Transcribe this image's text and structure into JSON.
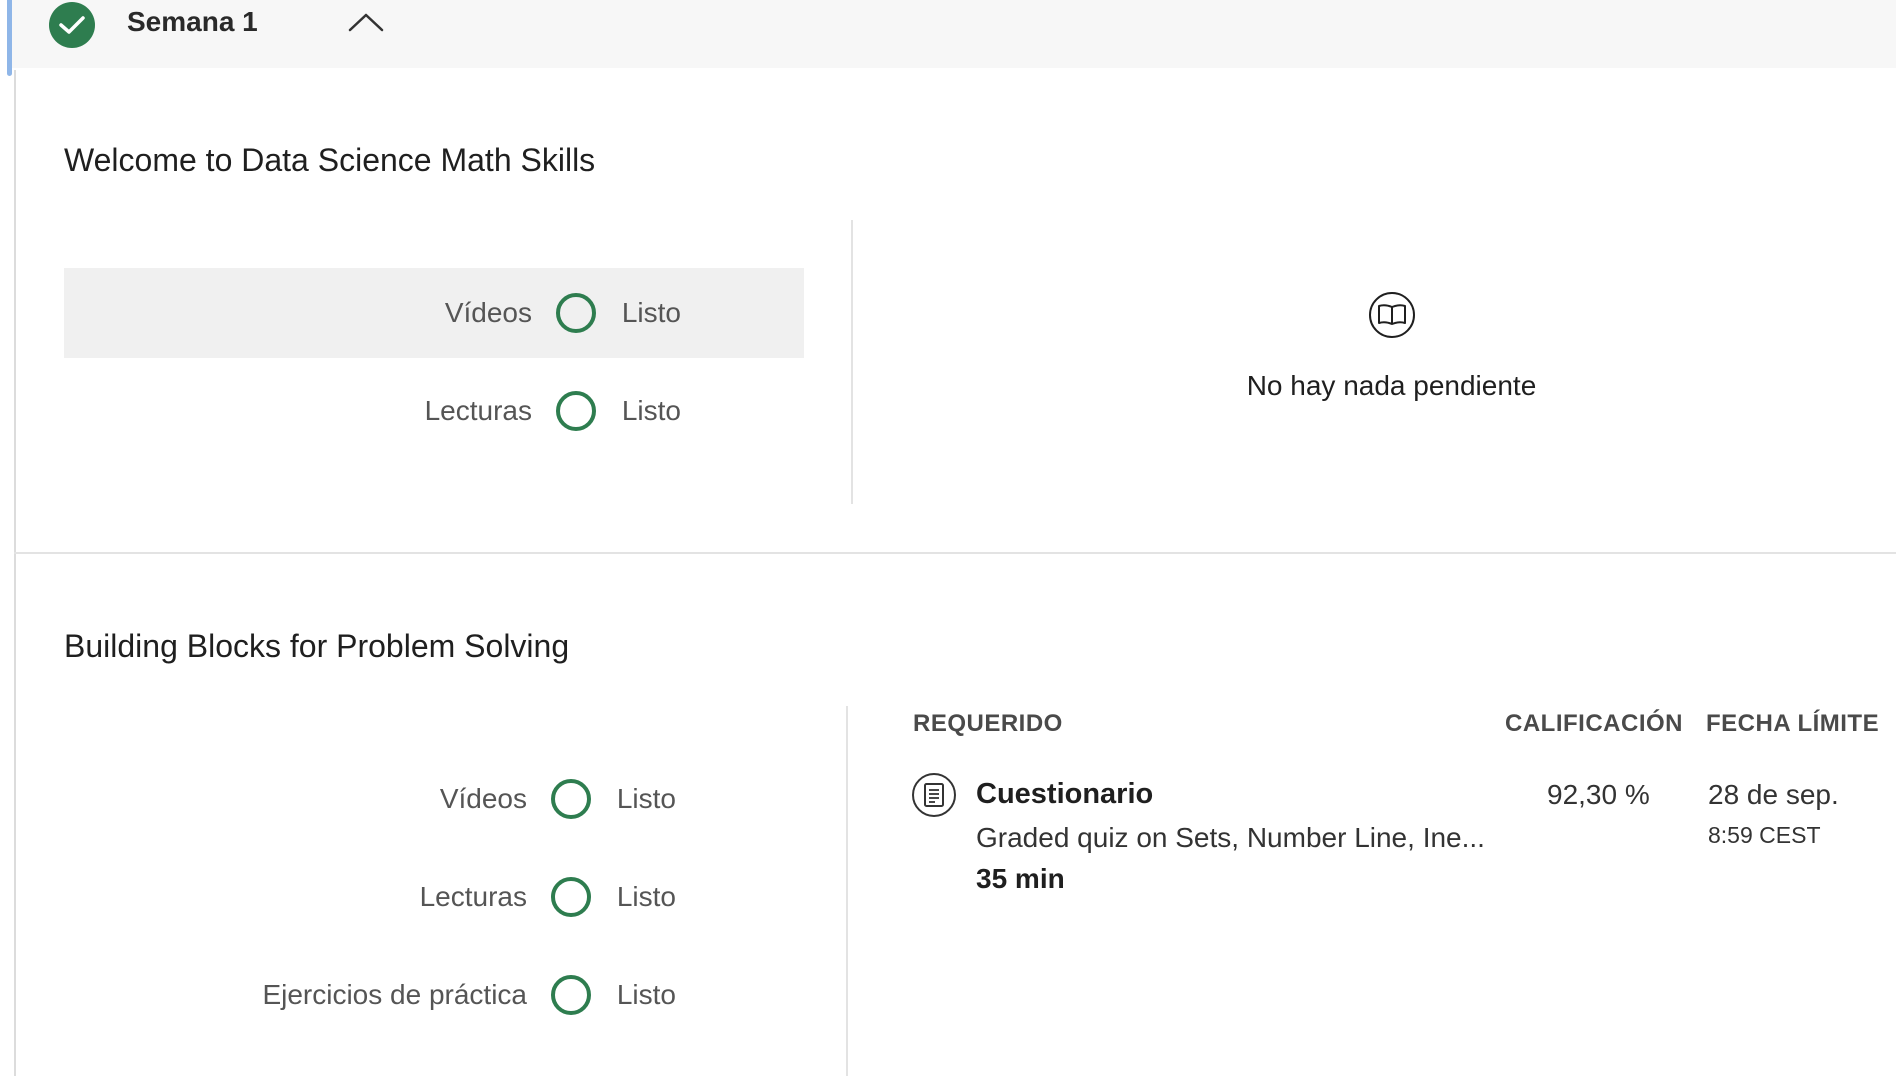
{
  "week": {
    "title": "Semana 1",
    "completed": true,
    "expanded": true
  },
  "modules": [
    {
      "title": "Welcome to Data Science Math Skills",
      "progress": [
        {
          "label": "Vídeos",
          "status": "Listo"
        },
        {
          "label": "Lecturas",
          "status": "Listo"
        }
      ],
      "empty_message": "No hay nada pendiente"
    },
    {
      "title": "Building Blocks for Problem Solving",
      "progress": [
        {
          "label": "Vídeos",
          "status": "Listo"
        },
        {
          "label": "Lecturas",
          "status": "Listo"
        },
        {
          "label": "Ejercicios de práctica",
          "status": "Listo"
        }
      ],
      "required_table": {
        "headers": {
          "required": "REQUERIDO",
          "grade": "CALIFICACIÓN",
          "due": "FECHA LÍMITE"
        },
        "items": [
          {
            "type": "Cuestionario",
            "description": "Graded quiz on Sets, Number Line, Ine...",
            "duration": "35 min",
            "grade": "92,30 %",
            "due_date": "28 de sep.",
            "due_time": "8:59 CEST"
          }
        ]
      }
    }
  ],
  "colors": {
    "accent_green": "#2e7d4f",
    "header_bg": "#f7f7f7",
    "highlight_bg": "#f0f0f0",
    "left_accent": "#8fb6e8"
  },
  "icons": {
    "week_status": "check-circle-icon",
    "collapse": "chevron-up-icon",
    "empty_state": "open-book-icon",
    "quiz": "quiz-document-icon"
  }
}
